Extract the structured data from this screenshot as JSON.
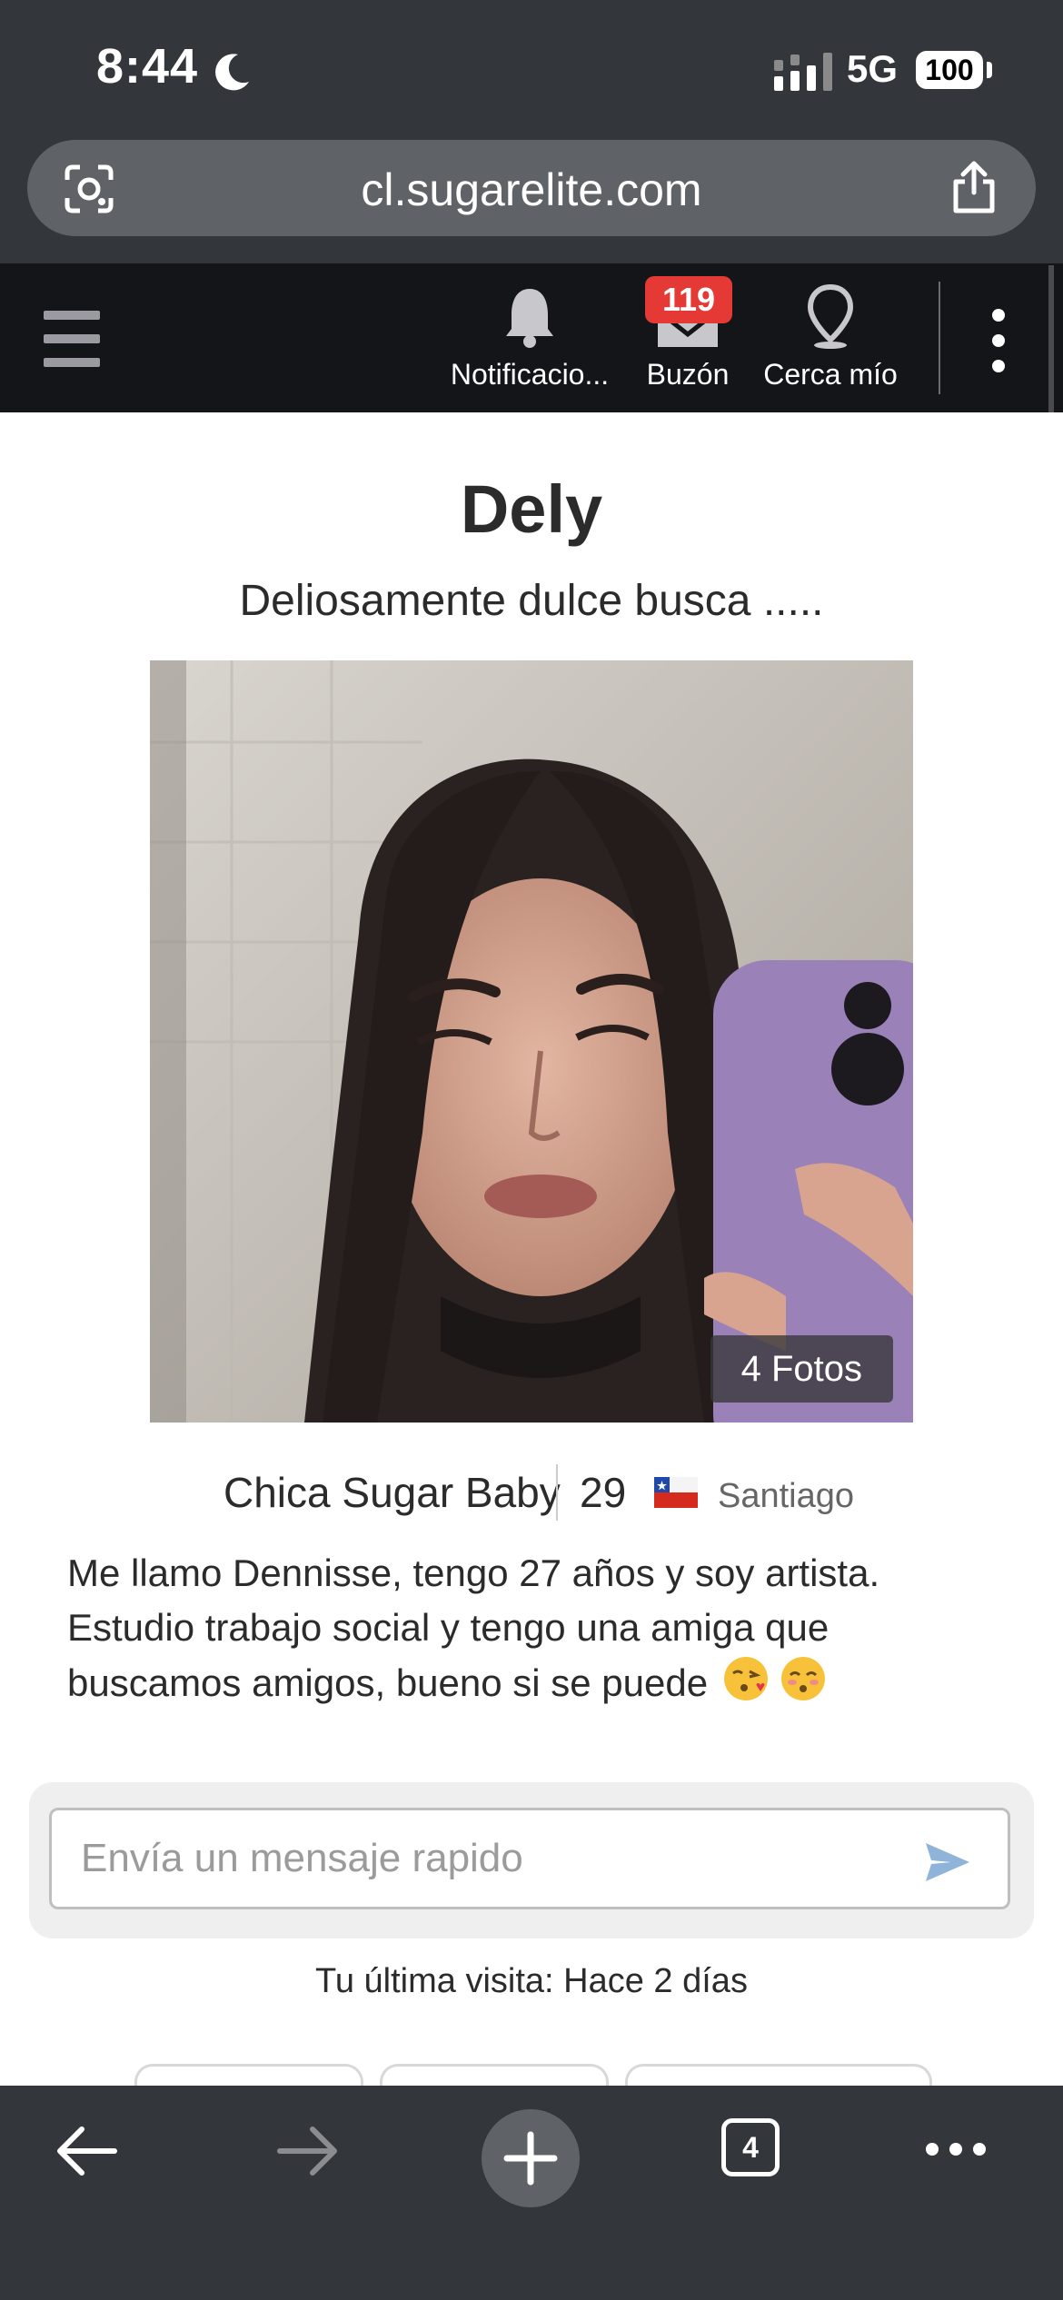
{
  "status_bar": {
    "time": "8:44",
    "network": "5G",
    "battery": "100"
  },
  "browser": {
    "url": "cl.sugarelite.com",
    "tab_count": "4"
  },
  "nav": {
    "notifications_label": "Notificacio...",
    "inbox_label": "Buzón",
    "inbox_badge": "119",
    "nearby_label": "Cerca mío"
  },
  "profile": {
    "name": "Dely",
    "tagline": "Deliosamente dulce busca .....",
    "photo_count": "4 Fotos",
    "type": "Chica Sugar Baby",
    "age": "29",
    "city": "Santiago",
    "country_flag": "Chile",
    "bio": "Me llamo Dennisse, tengo 27 años y soy artista. Estudio trabajo social y tengo una amiga que buscamos amigos, bueno si se puede",
    "bio_emojis": [
      "face-blowing-kiss",
      "kissing-face-smiling-eyes"
    ]
  },
  "message": {
    "placeholder": "Envía un mensaje rapido"
  },
  "last_visit": "Tu última visita: Hace 2 días",
  "colors": {
    "nav_bg": "#141519",
    "browser_chrome": "#33363b",
    "badge": "#e53935",
    "send_icon": "#8fb3d9"
  }
}
